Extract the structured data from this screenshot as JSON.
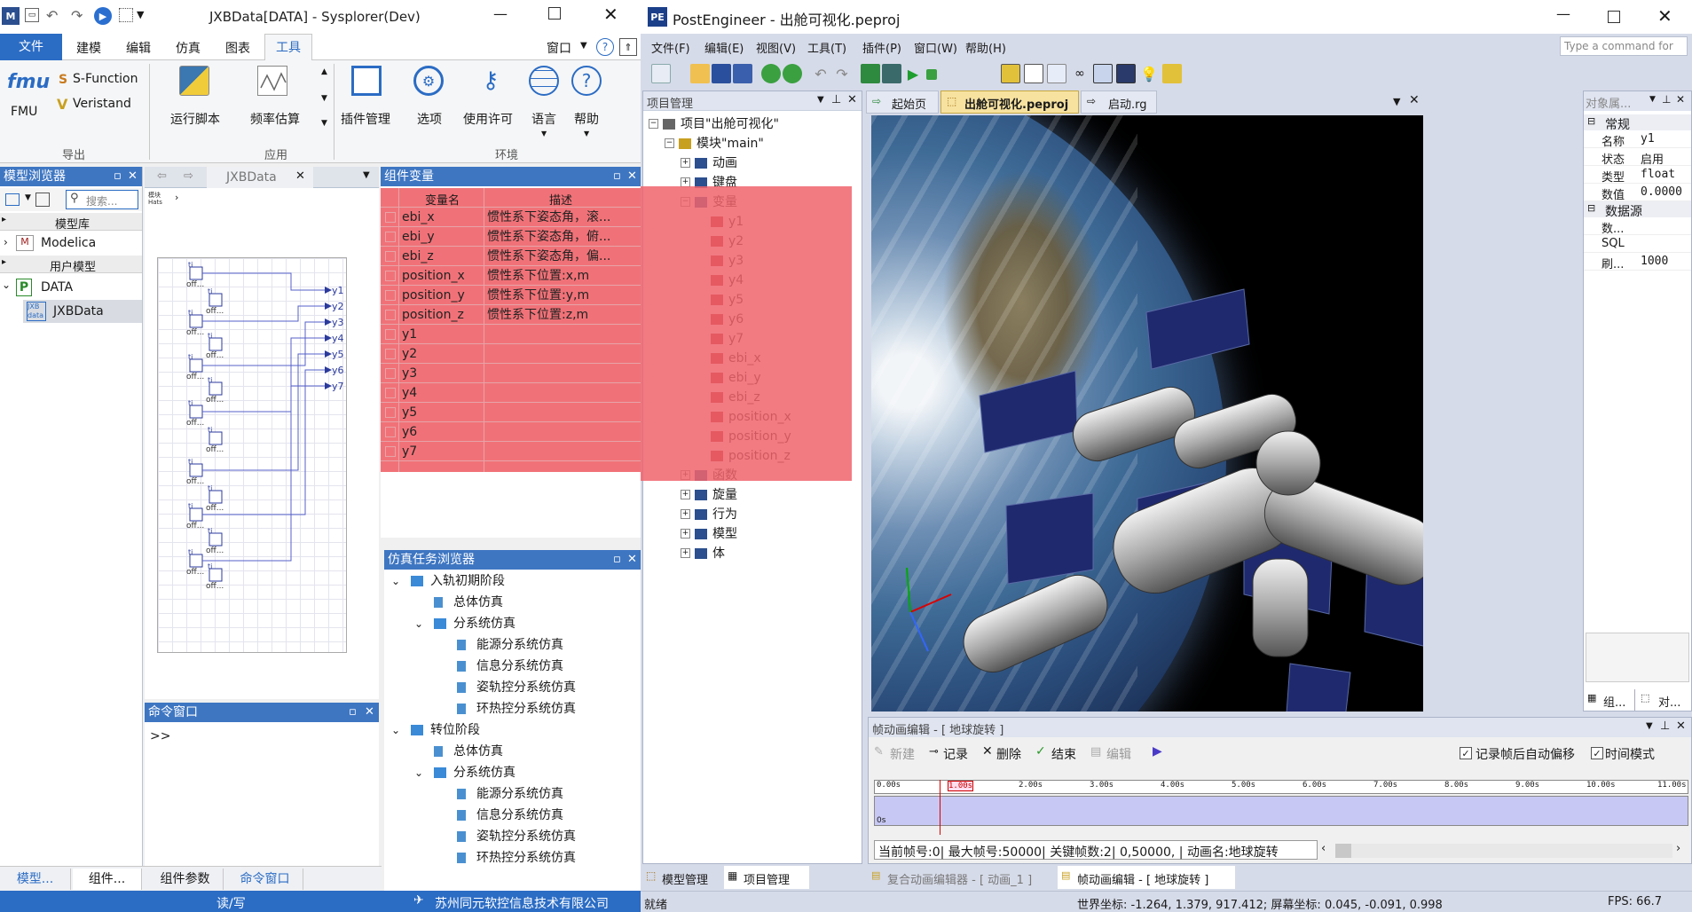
{
  "left_app": {
    "title": "JXBData[DATA] - Sysplorer(Dev)",
    "tabs": [
      "文件",
      "建模",
      "编辑",
      "仿真",
      "图表",
      "工具"
    ],
    "active_tab": "工具",
    "window_menu": "窗口",
    "ribbon": {
      "fmu_label": "fmu",
      "fmu_caption": "FMU",
      "sfunction": "S-Function",
      "veristand": "Veristand",
      "group_import": "导出",
      "run_script": "运行脚本",
      "freq_est": "频率估算",
      "group_apply": "应用",
      "plugin_mgr": "插件管理",
      "options": "选项",
      "license": "使用许可",
      "language": "语言",
      "help": "帮助",
      "group_env": "环境"
    },
    "model_browser": {
      "title": "模型浏览器",
      "search_placeholder": "搜索...",
      "lib_header": "模型库",
      "modelica": "Modelica",
      "user_header": "用户模型",
      "data": "DATA",
      "jxbdata": "JXBData",
      "jxb_icon_text": "JXB data"
    },
    "diagram": {
      "tab": "JXBData",
      "outputs": [
        "y1",
        "y2",
        "y3",
        "y4",
        "y5",
        "y6",
        "y7"
      ],
      "block_labels": [
        "off...",
        "off...",
        "off...",
        "off...",
        "off...",
        "off...",
        "off...",
        "off...",
        "off...",
        "off...",
        "off...",
        "off...",
        "off...",
        "off..."
      ],
      "ti": "ti",
      "corner": "模块 Hats"
    },
    "component_vars": {
      "title": "组件变量",
      "col_name": "变量名",
      "col_desc": "描述",
      "rows": [
        {
          "name": "ebi_x",
          "desc": "惯性系下姿态角，滚..."
        },
        {
          "name": "ebi_y",
          "desc": "惯性系下姿态角，俯..."
        },
        {
          "name": "ebi_z",
          "desc": "惯性系下姿态角，偏..."
        },
        {
          "name": "position_x",
          "desc": "惯性系下位置:x,m"
        },
        {
          "name": "position_y",
          "desc": "惯性系下位置:y,m"
        },
        {
          "name": "position_z",
          "desc": "惯性系下位置:z,m"
        },
        {
          "name": "y1",
          "desc": ""
        },
        {
          "name": "y2",
          "desc": ""
        },
        {
          "name": "y3",
          "desc": ""
        },
        {
          "name": "y4",
          "desc": ""
        },
        {
          "name": "y5",
          "desc": ""
        },
        {
          "name": "y6",
          "desc": ""
        },
        {
          "name": "y7",
          "desc": ""
        }
      ]
    },
    "sim_tasks": {
      "title": "仿真任务浏览器",
      "items": [
        {
          "text": "入轨初期阶段",
          "level": 0,
          "kind": "folder"
        },
        {
          "text": "总体仿真",
          "level": 1,
          "kind": "doc"
        },
        {
          "text": "分系统仿真",
          "level": 1,
          "kind": "folder"
        },
        {
          "text": "能源分系统仿真",
          "level": 2,
          "kind": "doc"
        },
        {
          "text": "信息分系统仿真",
          "level": 2,
          "kind": "doc"
        },
        {
          "text": "姿轨控分系统仿真",
          "level": 2,
          "kind": "doc"
        },
        {
          "text": "环热控分系统仿真",
          "level": 2,
          "kind": "doc"
        },
        {
          "text": "转位阶段",
          "level": 0,
          "kind": "folder"
        },
        {
          "text": "总体仿真",
          "level": 1,
          "kind": "doc"
        },
        {
          "text": "分系统仿真",
          "level": 1,
          "kind": "folder"
        },
        {
          "text": "能源分系统仿真",
          "level": 2,
          "kind": "doc"
        },
        {
          "text": "信息分系统仿真",
          "level": 2,
          "kind": "doc"
        },
        {
          "text": "姿轨控分系统仿真",
          "level": 2,
          "kind": "doc"
        },
        {
          "text": "环热控分系统仿真",
          "level": 2,
          "kind": "doc"
        }
      ]
    },
    "command_window": {
      "title": "命令窗口",
      "prompt": ">>"
    },
    "bottom_tabs": [
      "模型...",
      "组件...",
      "组件参数",
      "命令窗口"
    ],
    "status": {
      "rw": "读/写",
      "company": "苏州同元软控信息技术有限公司"
    }
  },
  "right_app": {
    "title": "PostEngineer - 出舱可视化.peproj",
    "logo": "PE",
    "menu": [
      "文件(F)",
      "编辑(E)",
      "视图(V)",
      "工具(T)",
      "插件(P)",
      "窗口(W)",
      "帮助(H)"
    ],
    "command_placeholder": "Type a command for",
    "project_panel": {
      "title": "项目管理",
      "items": [
        {
          "text": "项目\"出舱可视化\"",
          "level": 0
        },
        {
          "text": "模块\"main\"",
          "level": 1
        },
        {
          "text": "动画",
          "level": 2
        },
        {
          "text": "键盘",
          "level": 2
        },
        {
          "text": "变量",
          "level": 2
        },
        {
          "text": "y1",
          "level": 3
        },
        {
          "text": "y2",
          "level": 3
        },
        {
          "text": "y3",
          "level": 3
        },
        {
          "text": "y4",
          "level": 3
        },
        {
          "text": "y5",
          "level": 3
        },
        {
          "text": "y6",
          "level": 3
        },
        {
          "text": "y7",
          "level": 3
        },
        {
          "text": "ebi_x",
          "level": 3
        },
        {
          "text": "ebi_y",
          "level": 3
        },
        {
          "text": "ebi_z",
          "level": 3
        },
        {
          "text": "position_x",
          "level": 3
        },
        {
          "text": "position_y",
          "level": 3
        },
        {
          "text": "position_z",
          "level": 3
        },
        {
          "text": "函数",
          "level": 2
        },
        {
          "text": "旋量",
          "level": 2
        },
        {
          "text": "行为",
          "level": 2
        },
        {
          "text": "模型",
          "level": 2
        },
        {
          "text": "体",
          "level": 2
        }
      ]
    },
    "doc_tabs": [
      "起始页",
      "出舱可视化.peproj",
      "启动.rg"
    ],
    "active_doc_tab": "出舱可视化.peproj",
    "properties": {
      "title": "对象属...",
      "sec_general": "常规",
      "rows": [
        {
          "k": "名称",
          "v": "y1"
        },
        {
          "k": "状态",
          "v": "启用"
        },
        {
          "k": "类型",
          "v": "float"
        },
        {
          "k": "数值",
          "v": "0.0000"
        }
      ],
      "sec_source": "数据源",
      "rows2": [
        {
          "k": "数...",
          "v": ""
        },
        {
          "k": "SQL",
          "v": ""
        },
        {
          "k": "刷...",
          "v": "1000"
        }
      ],
      "tabs": [
        "组...",
        "对..."
      ]
    },
    "keyframe": {
      "title": "帧动画编辑 - [ 地球旋转 ]",
      "btn_new": "新建",
      "btn_record": "记录",
      "btn_delete": "删除",
      "btn_end": "结束",
      "btn_edit": "编辑",
      "chk_autosave": "记录帧后自动偏移",
      "chk_timemode": "时间模式",
      "ticks": [
        "0.00s",
        "1.00s",
        "2.00s",
        "3.00s",
        "4.00s",
        "5.00s",
        "6.00s",
        "7.00s",
        "8.00s",
        "9.00s",
        "10.00s",
        "11.00s"
      ],
      "track_label": "0s",
      "info": "当前帧号:0| 最大帧号:50000| 关键帧数:2| 0,50000, | 动画名:地球旋转"
    },
    "bottom_tabs_left": [
      "模型管理",
      "项目管理"
    ],
    "bottom_tabs_right": [
      "复合动画编辑器 - [ 动画_1 ]",
      "帧动画编辑 - [ 地球旋转 ]"
    ],
    "status": {
      "ready": "就绪",
      "world": "世界坐标: -1.264, 1.379, 917.412; 屏幕坐标: 0.045, -0.091, 0.998",
      "fps": "FPS: 66.7"
    }
  }
}
